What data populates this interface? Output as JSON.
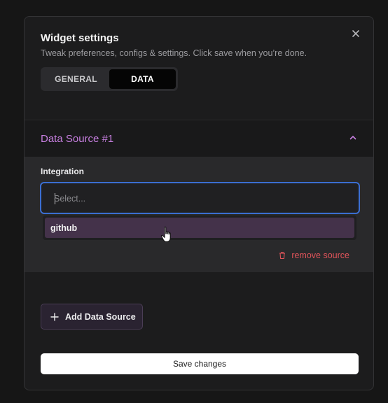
{
  "dialog": {
    "title": "Widget settings",
    "subtitle": "Tweak preferences, configs & settings. Click save when you’re done."
  },
  "tabs": [
    {
      "label": "GENERAL",
      "active": false
    },
    {
      "label": "DATA",
      "active": true
    }
  ],
  "data_source": {
    "title": "Data Source #1",
    "integration_label": "Integration",
    "select_placeholder": "Select...",
    "select_value": "",
    "options": [
      "github"
    ],
    "remove_label": "remove source"
  },
  "add_button_label": "Add Data Source",
  "save_button_label": "Save changes",
  "colors": {
    "accent": "#c77fe0",
    "danger": "#e0545a",
    "focus": "#3b6ed1"
  }
}
